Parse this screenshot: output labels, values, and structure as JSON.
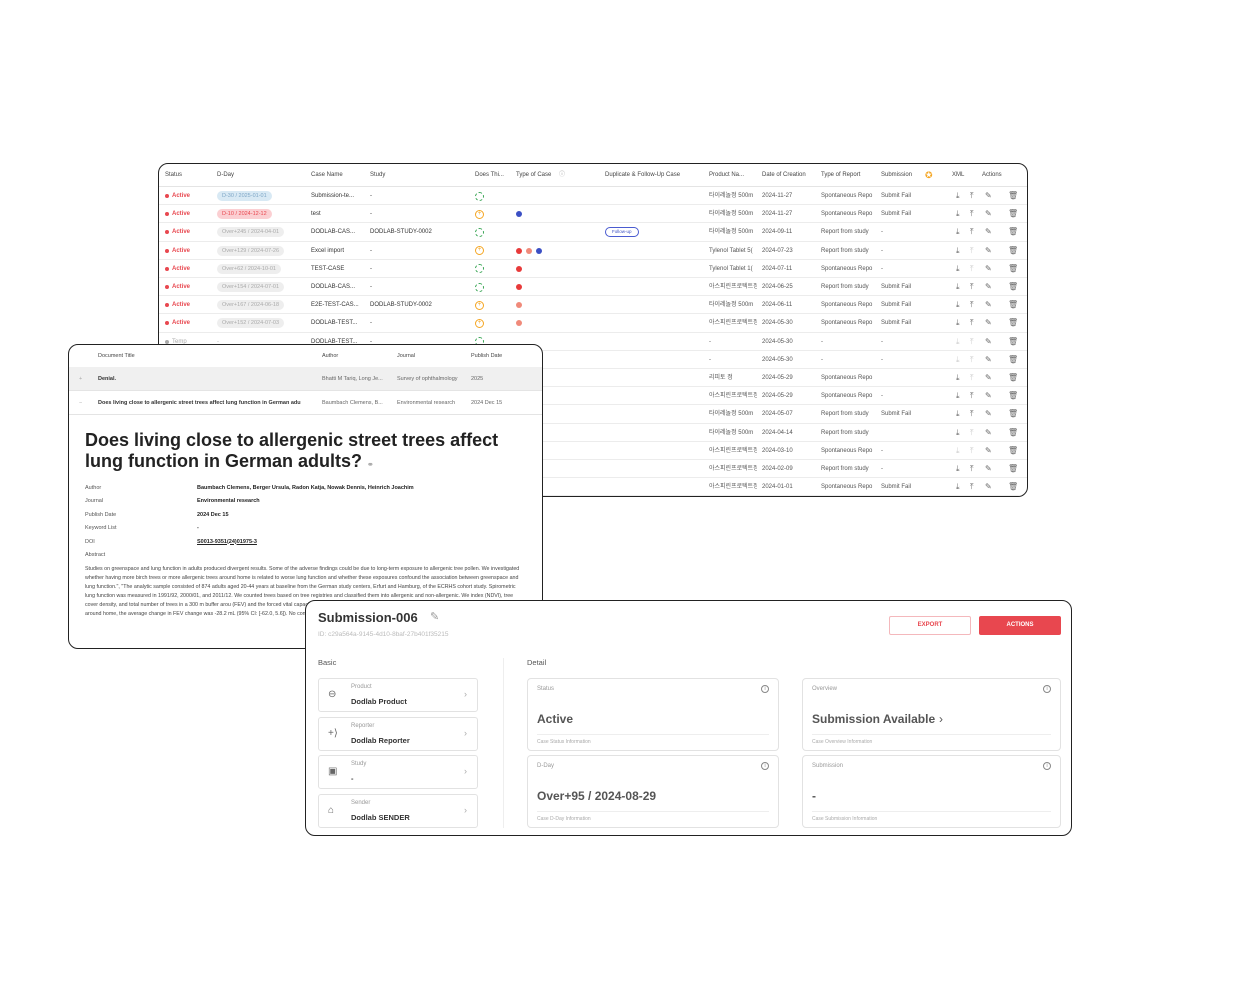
{
  "colors": {
    "accent": "#e8474f",
    "active": "#e8474f",
    "blue_dot": "#3b4fc4",
    "red_dot": "#e83a3a",
    "salmon_dot": "#f08a7a",
    "green": "#3aa655",
    "orange": "#f5a623"
  },
  "case_table": {
    "headers": {
      "status": "Status",
      "dday": "D-Day",
      "case_name": "Case Name",
      "study": "Study",
      "does_this": "Does Thi...",
      "type_of_case": "Type of Case",
      "duplicate": "Duplicate & Follow-Up Case",
      "product": "Product Na...",
      "date": "Date of Creation",
      "type_report": "Type of Report",
      "submission": "Submission",
      "xml": "XML",
      "actions": "Actions"
    },
    "rows": [
      {
        "status": "Active",
        "dday": "D-30 / 2025-01-01",
        "dday_style": "blue",
        "case_name": "Submission-te...",
        "study": "-",
        "does": "ok",
        "types": [],
        "dup": "",
        "product": "타이레놀정 500m",
        "date": "2024-11-27",
        "type_report": "Spontaneous Repo",
        "submission": "Submit Fail",
        "xml": [
          true,
          true
        ]
      },
      {
        "status": "Active",
        "dday": "D-10 / 2024-12-12",
        "dday_style": "red",
        "case_name": "test",
        "study": "-",
        "does": "plus",
        "types": [
          "blue"
        ],
        "dup": "",
        "product": "타이레놀정 500m",
        "date": "2024-11-27",
        "type_report": "Spontaneous Repo",
        "submission": "Submit Fail",
        "xml": [
          true,
          true
        ]
      },
      {
        "status": "Active",
        "dday": "Over+245 / 2024-04-01",
        "dday_style": "gray",
        "case_name": "DODLAB-CAS...",
        "study": "DODLAB-STUDY-0002",
        "does": "ok",
        "types": [],
        "dup": "Follow-up",
        "product": "타이레놀정 500m",
        "date": "2024-09-11",
        "type_report": "Report from study",
        "submission": "-",
        "xml": [
          true,
          true
        ]
      },
      {
        "status": "Active",
        "dday": "Over+129 / 2024-07-26",
        "dday_style": "gray",
        "case_name": "Excel import",
        "study": "-",
        "does": "plus",
        "types": [
          "red",
          "salmon",
          "blue"
        ],
        "dup": "",
        "product": "Tylenol Tablet 5(",
        "date": "2024-07-23",
        "type_report": "Report from study",
        "submission": "-",
        "xml": [
          true,
          false
        ]
      },
      {
        "status": "Active",
        "dday": "Over+62 / 2024-10-01",
        "dday_style": "gray",
        "case_name": "TEST-CASE",
        "study": "-",
        "does": "ok",
        "types": [
          "red"
        ],
        "dup": "",
        "product": "Tylenol Tablet 1(",
        "date": "2024-07-11",
        "type_report": "Spontaneous Repo",
        "submission": "-",
        "xml": [
          true,
          false
        ]
      },
      {
        "status": "Active",
        "dday": "Over+154 / 2024-07-01",
        "dday_style": "gray",
        "case_name": "DODLAB-CAS...",
        "study": "-",
        "does": "ok",
        "types": [
          "red"
        ],
        "dup": "",
        "product": "아스피린프로텍트정",
        "date": "2024-06-25",
        "type_report": "Report from study",
        "submission": "Submit Fail",
        "xml": [
          true,
          true
        ]
      },
      {
        "status": "Active",
        "dday": "Over+167 / 2024-06-18",
        "dday_style": "gray",
        "case_name": "E2E-TEST-CAS...",
        "study": "DODLAB-STUDY-0002",
        "does": "plus",
        "types": [
          "salmon"
        ],
        "dup": "",
        "product": "타이레놀정 500m",
        "date": "2024-06-11",
        "type_report": "Spontaneous Repo",
        "submission": "Submit Fail",
        "xml": [
          true,
          true
        ]
      },
      {
        "status": "Active",
        "dday": "Over+152 / 2024-07-03",
        "dday_style": "gray",
        "case_name": "DODLAB-TEST...",
        "study": "-",
        "does": "plus",
        "types": [
          "salmon"
        ],
        "dup": "",
        "product": "아스피린프로텍트정",
        "date": "2024-05-30",
        "type_report": "Spontaneous Repo",
        "submission": "Submit Fail",
        "xml": [
          true,
          true
        ]
      },
      {
        "status": "Temp",
        "dday": "-",
        "dday_style": "none",
        "case_name": "DODLAB-TEST...",
        "study": "-",
        "does": "ok",
        "types": [],
        "dup": "",
        "product": "-",
        "date": "2024-05-30",
        "type_report": "-",
        "submission": "-",
        "xml": [
          false,
          false
        ]
      },
      {
        "status": "",
        "dday": "",
        "dday_style": "none",
        "case_name": "",
        "study": "",
        "does": "",
        "types": [],
        "dup": "",
        "product": "-",
        "date": "2024-05-30",
        "type_report": "-",
        "submission": "-",
        "xml": [
          false,
          false
        ]
      },
      {
        "status": "",
        "dday": "",
        "dday_style": "none",
        "case_name": "",
        "study": "",
        "does": "",
        "types": [],
        "dup": "",
        "product": "리피토 정",
        "date": "2024-05-29",
        "type_report": "Spontaneous Repo",
        "submission": "",
        "xml": [
          true,
          false
        ]
      },
      {
        "status": "",
        "dday": "",
        "dday_style": "none",
        "case_name": "",
        "study": "",
        "does": "",
        "types": [],
        "dup": "",
        "product": "아스피린프로텍트정",
        "date": "2024-05-29",
        "type_report": "Spontaneous Repo",
        "submission": "-",
        "xml": [
          true,
          true
        ]
      },
      {
        "status": "",
        "dday": "",
        "dday_style": "none",
        "case_name": "",
        "study": "",
        "does": "",
        "types": [],
        "dup": "",
        "product": "타이레놀정 500m",
        "date": "2024-05-07",
        "type_report": "Report from study",
        "submission": "Submit Fail",
        "xml": [
          true,
          true
        ]
      },
      {
        "status": "",
        "dday": "",
        "dday_style": "none",
        "case_name": "",
        "study": "",
        "does": "",
        "types": [],
        "dup": "",
        "product": "타이레놀정 500m",
        "date": "2024-04-14",
        "type_report": "Report from study",
        "submission": "",
        "xml": [
          true,
          false
        ]
      },
      {
        "status": "",
        "dday": "",
        "dday_style": "none",
        "case_name": "",
        "study": "",
        "does": "",
        "types": [],
        "dup": "",
        "product": "아스피린프로텍트정",
        "date": "2024-03-10",
        "type_report": "Spontaneous Repo",
        "submission": "-",
        "xml": [
          false,
          false
        ]
      },
      {
        "status": "",
        "dday": "",
        "dday_style": "none",
        "case_name": "",
        "study": "",
        "does": "",
        "types": [],
        "dup": "",
        "product": "아스피린프로텍트정",
        "date": "2024-02-09",
        "type_report": "Report from study",
        "submission": "-",
        "xml": [
          true,
          true
        ]
      },
      {
        "status": "",
        "dday": "",
        "dday_style": "none",
        "case_name": "",
        "study": "",
        "does": "",
        "types": [],
        "dup": "",
        "product": "아스피린프로텍트정",
        "date": "2024-01-01",
        "type_report": "Spontaneous Repo",
        "submission": "Submit Fail",
        "xml": [
          true,
          true
        ]
      }
    ]
  },
  "paper": {
    "headers": {
      "title": "Document Title",
      "author": "Author",
      "journal": "Journal",
      "date": "Publish Date"
    },
    "rows": [
      {
        "toggle": "+",
        "title": "Denial.",
        "author": "Bhatti M Tariq, Long Je...",
        "journal": "Survey of ophthalmology",
        "date": "2025"
      },
      {
        "toggle": "−",
        "title": "Does living close to allergenic street trees affect lung function in German adu",
        "author": "Baumbach Clemens, B...",
        "journal": "Environmental research",
        "date": "2024 Dec 15"
      }
    ],
    "title": "Does living close to allergenic street trees affect lung function in German adults?",
    "meta": [
      {
        "label": "Author",
        "value": "Baumbach Clemens, Berger Ursula, Radon Katja, Nowak Dennis, Heinrich Joachim"
      },
      {
        "label": "Journal",
        "value": "Environmental research"
      },
      {
        "label": "Publish Date",
        "value": "2024 Dec 15"
      },
      {
        "label": "Keyword List",
        "value": "-"
      },
      {
        "label": "DOI",
        "value": "S0013-9351(24)01975-3"
      },
      {
        "label": "Abstract",
        "value": ""
      }
    ],
    "abstract": "Studies on greenspace and lung function in adults produced divergent results. Some of the adverse findings could be due to long-term exposure to allergenic tree pollen. We investigated whether having more birch trees or more allergenic trees around home is related to worse lung function and whether these exposures confound the association between greenspace and lung function.\", \"The analytic sample consisted of 874 adults aged 20-44 years at baseline from the German study centers, Erfurt and Hamburg, of the ECRHS cohort study. Spirometric lung function was measured in 1991/92, 2000/01, and 2011/12. We counted trees based on tree registries and classified them into allergenic and non-allergenic. We index (NDVI), tree cover density, and total number of trees in a 300 m buffer arou (FEV) and the forced vital capacity (FVC) were decreased in the presence of more additional birch trees in a 300 m buffer around home, the average change in FEV change was -28.2 mL (95% CI: [-62.0, 5.6]). No consistent associations were foun"
  },
  "submission": {
    "title": "Submission-006",
    "id": "ID: c29a564a-9145-4d10-8baf-27b401f35215",
    "export_label": "EXPORT",
    "actions_label": "ACTIONS",
    "basic_label": "Basic",
    "detail_label": "Detail",
    "basic": [
      {
        "label": "Product",
        "value": "Dodlab Product",
        "icon": "pill-icon"
      },
      {
        "label": "Reporter",
        "value": "Dodlab Reporter",
        "icon": "reporter-icon"
      },
      {
        "label": "Study",
        "value": "-",
        "icon": "calendar-icon"
      },
      {
        "label": "Sender",
        "value": "Dodlab SENDER",
        "icon": "inbox-icon"
      }
    ],
    "detail": [
      {
        "label": "Status",
        "value": "Active",
        "footer": "Case Status Information"
      },
      {
        "label": "Overview",
        "value": "Submission Available",
        "footer": "Case Overview Information"
      },
      {
        "label": "D-Day",
        "value": "Over+95 / 2024-08-29",
        "footer": "Case D-Day Information"
      },
      {
        "label": "Submission",
        "value": "-",
        "footer": "Case Submission Information"
      }
    ]
  }
}
